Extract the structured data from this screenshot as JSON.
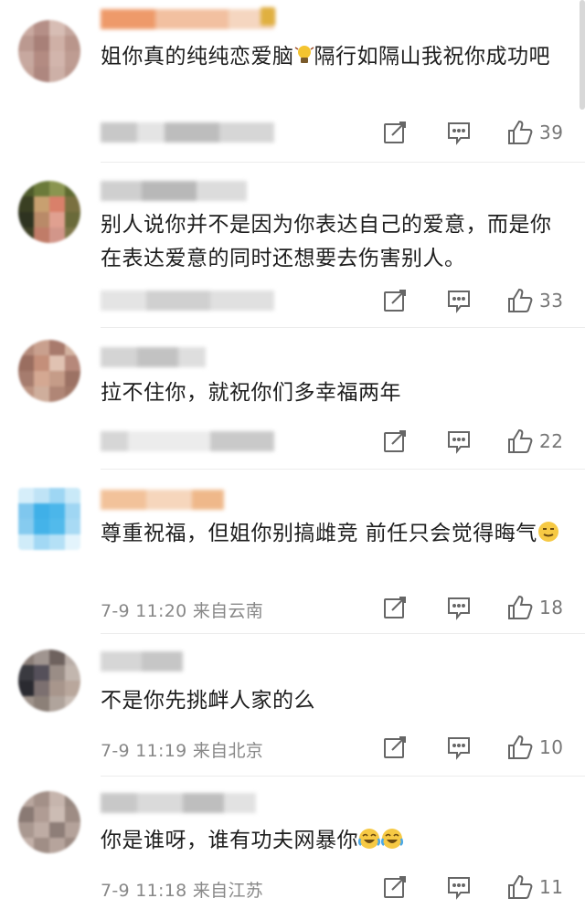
{
  "comments": [
    {
      "text": "姐你真的纯纯恋爱脑",
      "text_after_emoji": "隔行如隔山我祝你成功吧",
      "emoji": "lightbulb-emoji",
      "meta": "",
      "likes": "39",
      "avatar_colors": [
        "#c9a9a0",
        "#b58f87",
        "#d7bdb4",
        "#c4a59c",
        "#bb9990",
        "#a88078",
        "#cfb0a6",
        "#b9958b",
        "#c7a89f",
        "#b38b82",
        "#d2b5ac",
        "#be9c92",
        "#c6a59b",
        "#ae877f",
        "#cdb0a7",
        "#bc998f"
      ]
    },
    {
      "text": "别人说你并不是因为你表达自己的爱意，而是你在表达爱意的同时还想要去伤害别人。",
      "meta": "",
      "likes": "33",
      "avatar_colors": [
        "#4d5a2a",
        "#6b7a3a",
        "#8a9550",
        "#5e6a30",
        "#3a3f22",
        "#c8a070",
        "#d9806a",
        "#7a7040",
        "#2e3320",
        "#b98a68",
        "#e0a090",
        "#6a6a3a",
        "#3d4025",
        "#c07c68",
        "#d2968a",
        "#7d7648"
      ]
    },
    {
      "text": "拉不住你，就祝你们多幸福两年",
      "meta": "",
      "likes": "22",
      "avatar_colors": [
        "#b48a7a",
        "#c9a08e",
        "#a87a6c",
        "#d3b2a0",
        "#9a6e60",
        "#c48f7a",
        "#e0c2b2",
        "#b6887a",
        "#a67c6e",
        "#d4a892",
        "#c59c88",
        "#9c7264",
        "#bd9482",
        "#cfae9c",
        "#b08676",
        "#a27868"
      ]
    },
    {
      "text": "尊重祝福，但姐你别搞雌竞 前任只会觉得晦气",
      "emoji": "grimace-emoji",
      "meta": "7-9 11:20 来自云南",
      "likes": "18",
      "avatar_colors": [
        "#d6eefa",
        "#bfe3f6",
        "#9ed6f3",
        "#c9e9f8",
        "#7fc7ee",
        "#3fb0e8",
        "#4bb6ea",
        "#9fd6f3",
        "#86cbef",
        "#44b3e9",
        "#52baeb",
        "#a8daf4",
        "#d0ecf9",
        "#a2d8f4",
        "#b4e0f6",
        "#e3f4fc"
      ]
    },
    {
      "text": "不是你先挑衅人家的么",
      "meta": "7-9 11:19 来自北京",
      "likes": "10",
      "avatar_colors": [
        "#8a7e78",
        "#a09590",
        "#6e625e",
        "#b8aca6",
        "#3a3a40",
        "#55505a",
        "#9a8d86",
        "#c2b6ae",
        "#2a2a30",
        "#7c7070",
        "#a8968c",
        "#b9a79c",
        "#9e928a",
        "#8c8078",
        "#b0a49c",
        "#c8bcb4"
      ]
    },
    {
      "text": "你是谁呀，谁有功夫网暴你",
      "emoji": "crying-laughing-emoji",
      "meta": "7-9 11:18 来自江苏",
      "likes": "11",
      "avatar_colors": [
        "#b8a69e",
        "#a39088",
        "#c6b5ad",
        "#988880",
        "#8a7a74",
        "#b09c94",
        "#ccbcb4",
        "#9e8c84",
        "#a99890",
        "#beaca4",
        "#8e7e78",
        "#b4a29a",
        "#c2b0a8",
        "#a08e86",
        "#b6a49c",
        "#9c8a82"
      ]
    }
  ]
}
